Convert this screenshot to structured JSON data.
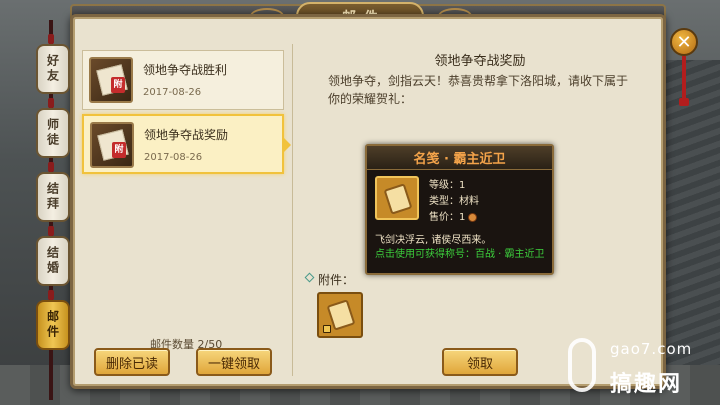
{
  "window": {
    "title": "邮件"
  },
  "side_tabs": [
    {
      "label": "好友",
      "active": false
    },
    {
      "label": "师徒",
      "active": false
    },
    {
      "label": "结拜",
      "active": false
    },
    {
      "label": "结婚",
      "active": false
    },
    {
      "label": "邮件",
      "active": true
    }
  ],
  "mail_list": [
    {
      "title": "领地争夺战胜利",
      "date": "2017-08-26",
      "selected": false,
      "stamp": "附"
    },
    {
      "title": "领地争夺战奖励",
      "date": "2017-08-26",
      "selected": true,
      "stamp": "附"
    }
  ],
  "mail_count": "邮件数量 2/50",
  "buttons": {
    "delete_read": "删除已读",
    "claim_all": "一键领取",
    "claim": "领取"
  },
  "detail": {
    "title": "领地争夺战奖励",
    "body": "领地争夺，剑指云天！恭喜贵帮拿下洛阳城，请收下属于你的荣耀贺礼："
  },
  "item_card": {
    "name": "名笺 · 霸主近卫",
    "name_color": "#f3a34a",
    "level": "等级：1",
    "type": "类型：材料",
    "price": "售价：1",
    "description": "飞剑决浮云, 诸侯尽西来。",
    "hint": "点击使用可获得称号：百战 · 霸主近卫",
    "hint_color": "#3ccf3c"
  },
  "attachments": {
    "label": "附件："
  },
  "watermark": {
    "url": "gao7.com",
    "name": "搞趣网"
  },
  "colors": {
    "selected_border": "#f1c23c",
    "button_fill": "#e0a63a",
    "panel_bg": "#e9e2cf"
  }
}
